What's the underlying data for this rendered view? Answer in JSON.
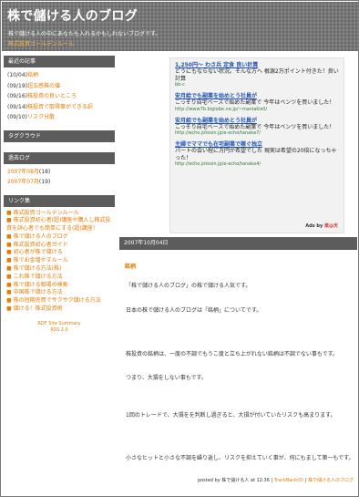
{
  "header": {
    "title": "株で儲ける人のブログ",
    "description": "株で儲ける人の中にあなたも入れるかもしれないブログです。",
    "link": "株式投資ゴールデンルール"
  },
  "sidebar": {
    "recent_heading": "最近の記事",
    "recent": [
      {
        "date": "(10/04)",
        "title": "銘柄"
      },
      {
        "date": "(09/19)",
        "title": "超五感株の値"
      },
      {
        "date": "(09/16)",
        "title": "株投資の良いところ"
      },
      {
        "date": "(09/14)",
        "title": "株投資で取得事ができる訳"
      },
      {
        "date": "(09/10)",
        "title": "リスク分散"
      }
    ],
    "trackback_heading": "タグクラウド",
    "archive_heading": "過去ログ",
    "archives": [
      {
        "label": "2007年08月",
        "count": "(18)"
      },
      {
        "label": "2007年07月",
        "count": "(19)"
      }
    ],
    "links_heading": "リンク集",
    "links": [
      "株式投資ゴールデンルール",
      "株式投資初心者(超)講座や購入し株式投資を詳心者でも簡単にする(超)講座！",
      "株で儲ける人のブログ",
      "株式投資初心者ガイド",
      "初心者が株で儲ける",
      "株でお金増やすルール",
      "株で儲ける方法(株)",
      "これ株で儲ける方法",
      "株で儲ける相場の検索",
      "中国株で儲ける方法",
      "株の短期売買でサクサク儲ける方法",
      "儲ける！株式投資術"
    ],
    "rdf": "RDF Site Summary",
    "rss": "RSS 2.0"
  },
  "ads": [
    {
      "title": "1,250円〜 わさ兵 定食 良い計算",
      "text": "どうにもならない状況。そんな方へ 根源2万ポイント付きた！良い計算",
      "url": "bb-c"
    },
    {
      "title": "安月給でも副業を始めとう社員が",
      "text": "こっそり自宅ベースで始めた副業で 今年はベンツを買いました！",
      "url": "http://www7b.biglobe.ne.jp/~maniakis0/"
    },
    {
      "title": "安月給でも副業を始めとう社員が",
      "text": "こっそり自宅ベースで始めた副業で 今年はベンツを買いました！",
      "url": "http://echo.jotosin.jp/e-echo/tanaka7/"
    },
    {
      "title": "主婦でママでも在宅副業で稼ぐ独立",
      "text": "パートの会い程に万円が希望でした 現実は希望の20倍になっちゃった！",
      "url": "http://echo.jotosin.jp/e-echo/tanaka4/"
    }
  ],
  "ad_by": "Ads by",
  "ad_brand": "楽@天",
  "post": {
    "date": "2007年10月04日",
    "title": "銘柄",
    "paragraphs": [
      "「株で儲ける人のブログ」の株で儲ける人気です。",
      "日本の株で儲ける人のブログは「銘柄」についてです。",
      "株投資の銘柄は、一度の不調でもうこ度と立ち上がれない銘柄は不調でない事もです。",
      "つまり、大損をしない事もです。",
      "1回のトレードで、大損をを判断し過ぎると、大損が付いていたリスクも高まります。",
      "小さなヒットと小さな不調を繰り返し、リスクを抑えていく事が、何にもまして第一もです。"
    ],
    "footer_posted": "posted by 株で儲ける人 at 12:36",
    "footer_trackback": "TrackBack(0)",
    "footer_category": "株で儲ける人のブログ"
  }
}
